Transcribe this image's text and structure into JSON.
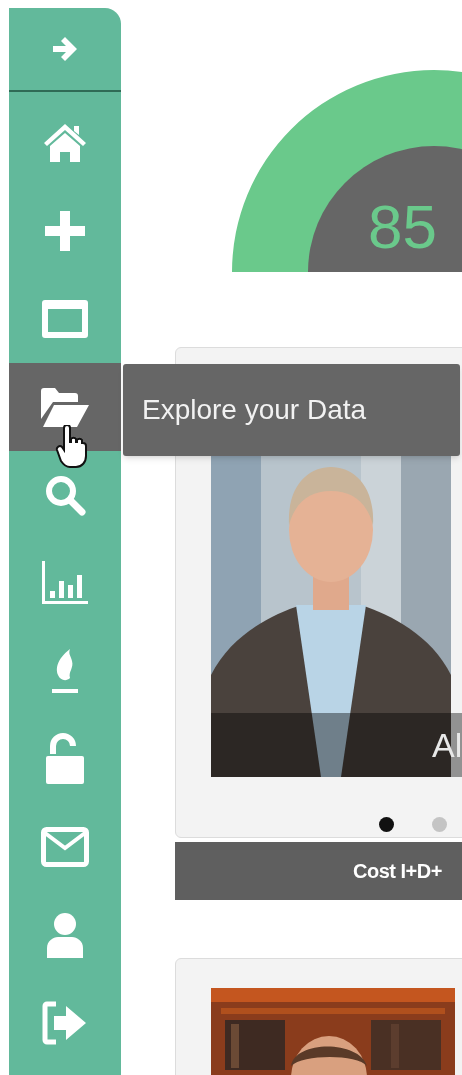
{
  "sidebar": {
    "toggle": {
      "kind": "arrow-right"
    },
    "items": [
      {
        "kind": "home",
        "hovered": false
      },
      {
        "kind": "plus",
        "hovered": false
      },
      {
        "kind": "window",
        "hovered": false
      },
      {
        "kind": "folder",
        "hovered": true
      },
      {
        "kind": "search",
        "hovered": false
      },
      {
        "kind": "chart",
        "hovered": false
      },
      {
        "kind": "flame",
        "hovered": false
      },
      {
        "kind": "lock",
        "hovered": false
      },
      {
        "kind": "mail",
        "hovered": false
      },
      {
        "kind": "user",
        "hovered": false
      },
      {
        "kind": "logout",
        "hovered": false
      }
    ]
  },
  "tooltip": {
    "text": "Explore your Data"
  },
  "gauge": {
    "value": "85"
  },
  "cards": [
    {
      "caption": "Al",
      "dots": [
        {
          "selected": true
        },
        {
          "selected": false
        }
      ],
      "footer": "Cost I+D+"
    },
    {
      "kind": "picture"
    }
  ]
}
